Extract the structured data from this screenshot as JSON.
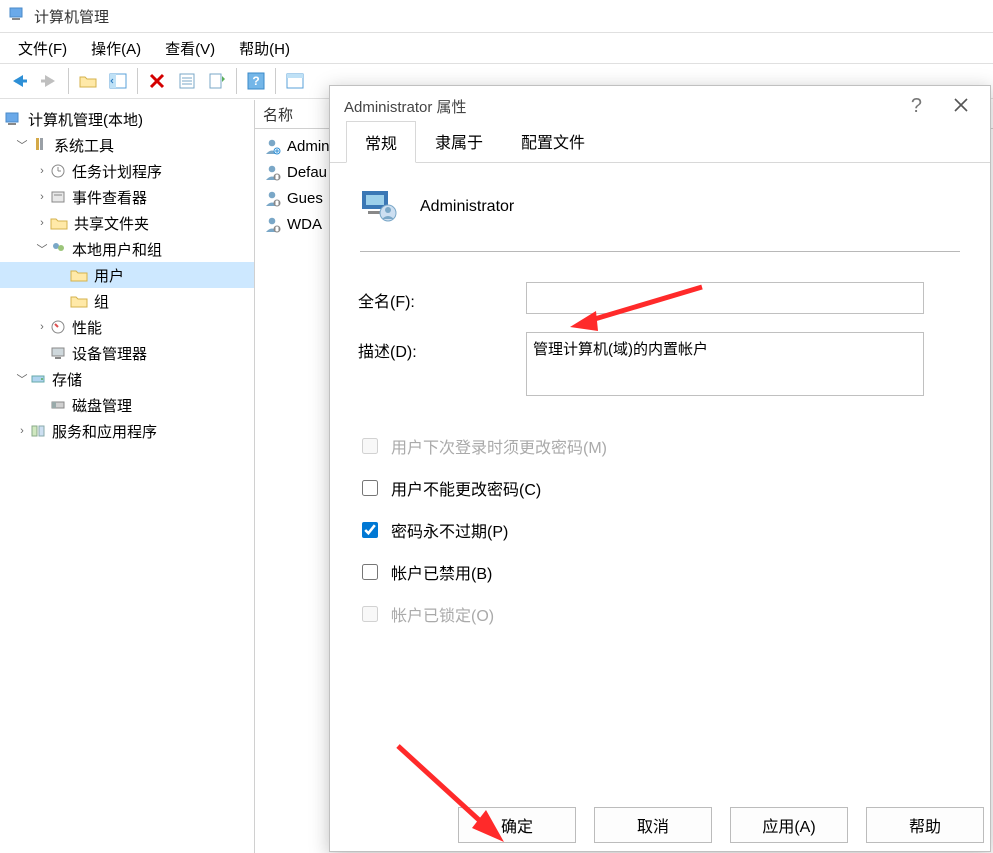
{
  "window": {
    "title": "计算机管理"
  },
  "menu": {
    "file": "文件(F)",
    "action": "操作(A)",
    "view": "查看(V)",
    "help": "帮助(H)"
  },
  "tree": {
    "root": "计算机管理(本地)",
    "system_tools": "系统工具",
    "task_scheduler": "任务计划程序",
    "event_viewer": "事件查看器",
    "shared_folders": "共享文件夹",
    "local_users_groups": "本地用户和组",
    "users": "用户",
    "groups": "组",
    "performance": "性能",
    "device_manager": "设备管理器",
    "storage": "存储",
    "disk_management": "磁盘管理",
    "services": "服务和应用程序"
  },
  "list": {
    "header": "名称",
    "items": [
      "Administrator",
      "DefaultAccount",
      "Guest",
      "WDAGUtilityAccount"
    ],
    "display": [
      "Admini",
      "Defau",
      "Gues",
      "WDA"
    ]
  },
  "dialog": {
    "title": "Administrator 属性",
    "help": "?",
    "close": "✕",
    "tabs": {
      "general": "常规",
      "member_of": "隶属于",
      "profile": "配置文件"
    },
    "user_name": "Administrator",
    "full_name_label": "全名(F):",
    "full_name_value": "",
    "description_label": "描述(D):",
    "description_value": "管理计算机(域)的内置帐户",
    "chk_must_change": "用户下次登录时须更改密码(M)",
    "chk_cannot_change": "用户不能更改密码(C)",
    "chk_never_expire": "密码永不过期(P)",
    "chk_disabled": "帐户已禁用(B)",
    "chk_locked": "帐户已锁定(O)",
    "buttons": {
      "ok": "确定",
      "cancel": "取消",
      "apply": "应用(A)",
      "help": "帮助"
    }
  }
}
